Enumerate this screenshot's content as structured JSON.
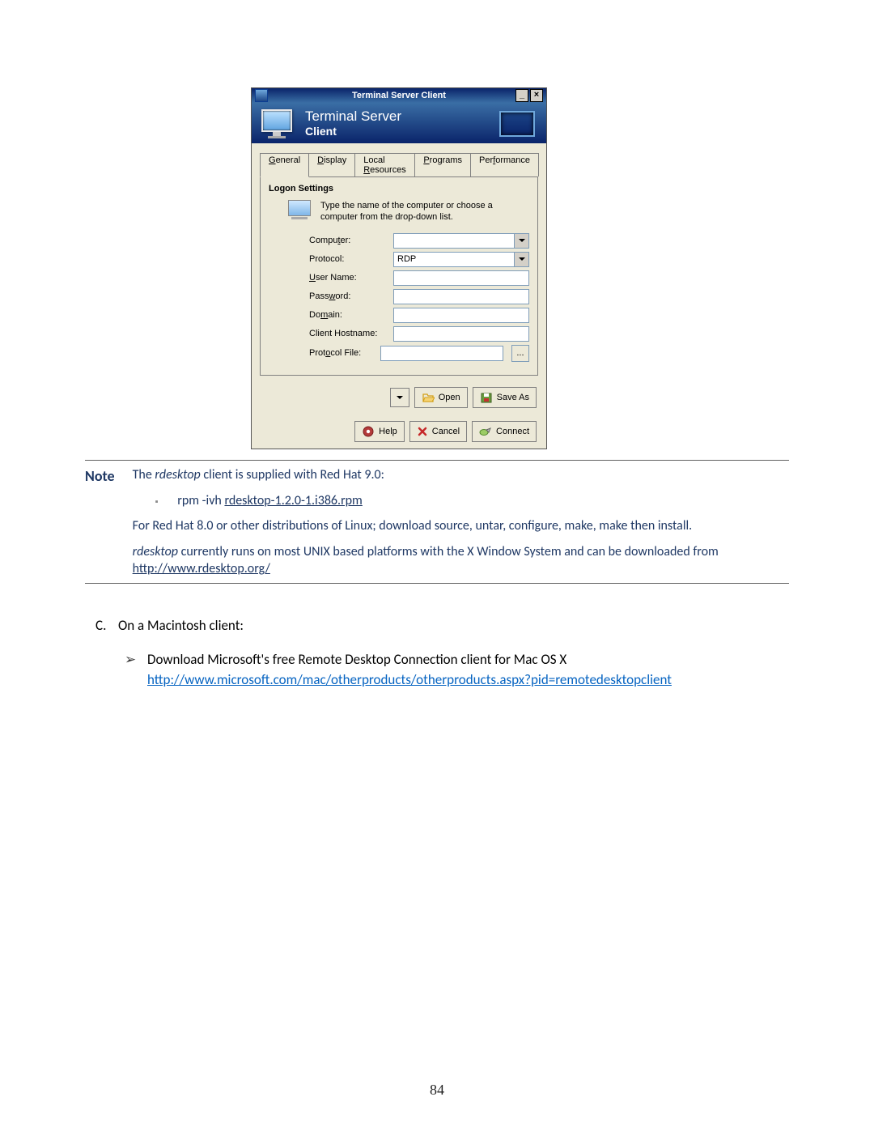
{
  "dialog": {
    "title": "Terminal Server Client",
    "banner_line1": "Terminal Server",
    "banner_line2": "Client",
    "tabs": {
      "general": "General",
      "display": "Display",
      "local_resources": "Local Resources",
      "programs": "Programs",
      "performance": "Performance"
    },
    "section_heading": "Logon Settings",
    "instruction": "Type the name of the computer or choose a computer from the drop-down list.",
    "fields": {
      "computer_label": "Computer:",
      "computer_value": "",
      "protocol_label": "Protocol:",
      "protocol_value": "RDP",
      "username_label": "User Name:",
      "username_value": "",
      "password_label": "Password:",
      "password_value": "",
      "domain_label": "Domain:",
      "domain_value": "",
      "client_hostname_label": "Client Hostname:",
      "client_hostname_value": "",
      "protocol_file_label": "Protocol File:",
      "protocol_file_value": "",
      "browse_label": "..."
    },
    "buttons": {
      "open": "Open",
      "save_as": "Save As",
      "help": "Help",
      "cancel": "Cancel",
      "connect": "Connect"
    }
  },
  "note": {
    "label": "Note",
    "intro_pre": "The ",
    "intro_italic": "rdesktop",
    "intro_post": " client is supplied with Red Hat 9.0:",
    "bullet_pre": "rpm -ivh ",
    "bullet_link": "rdesktop-1.2.0-1.i386.rpm",
    "p2": "For Red Hat 8.0 or other distributions of Linux; download source, untar, configure, make, make then install.",
    "p3_pre_italic": "rdesktop",
    "p3_mid": " currently runs on most UNIX based platforms with the X Window System and can be downloaded from ",
    "p3_link": "http://www.rdesktop.org/"
  },
  "section_c": {
    "letter": "C.",
    "heading": "On a Macintosh client:",
    "arrow": "➢",
    "bullet_text": "Download Microsoft's free Remote Desktop Connection client for Mac OS X",
    "link": "http://www.microsoft.com/mac/otherproducts/otherproducts.aspx?pid=remotedesktopclient"
  },
  "page_number": "84"
}
